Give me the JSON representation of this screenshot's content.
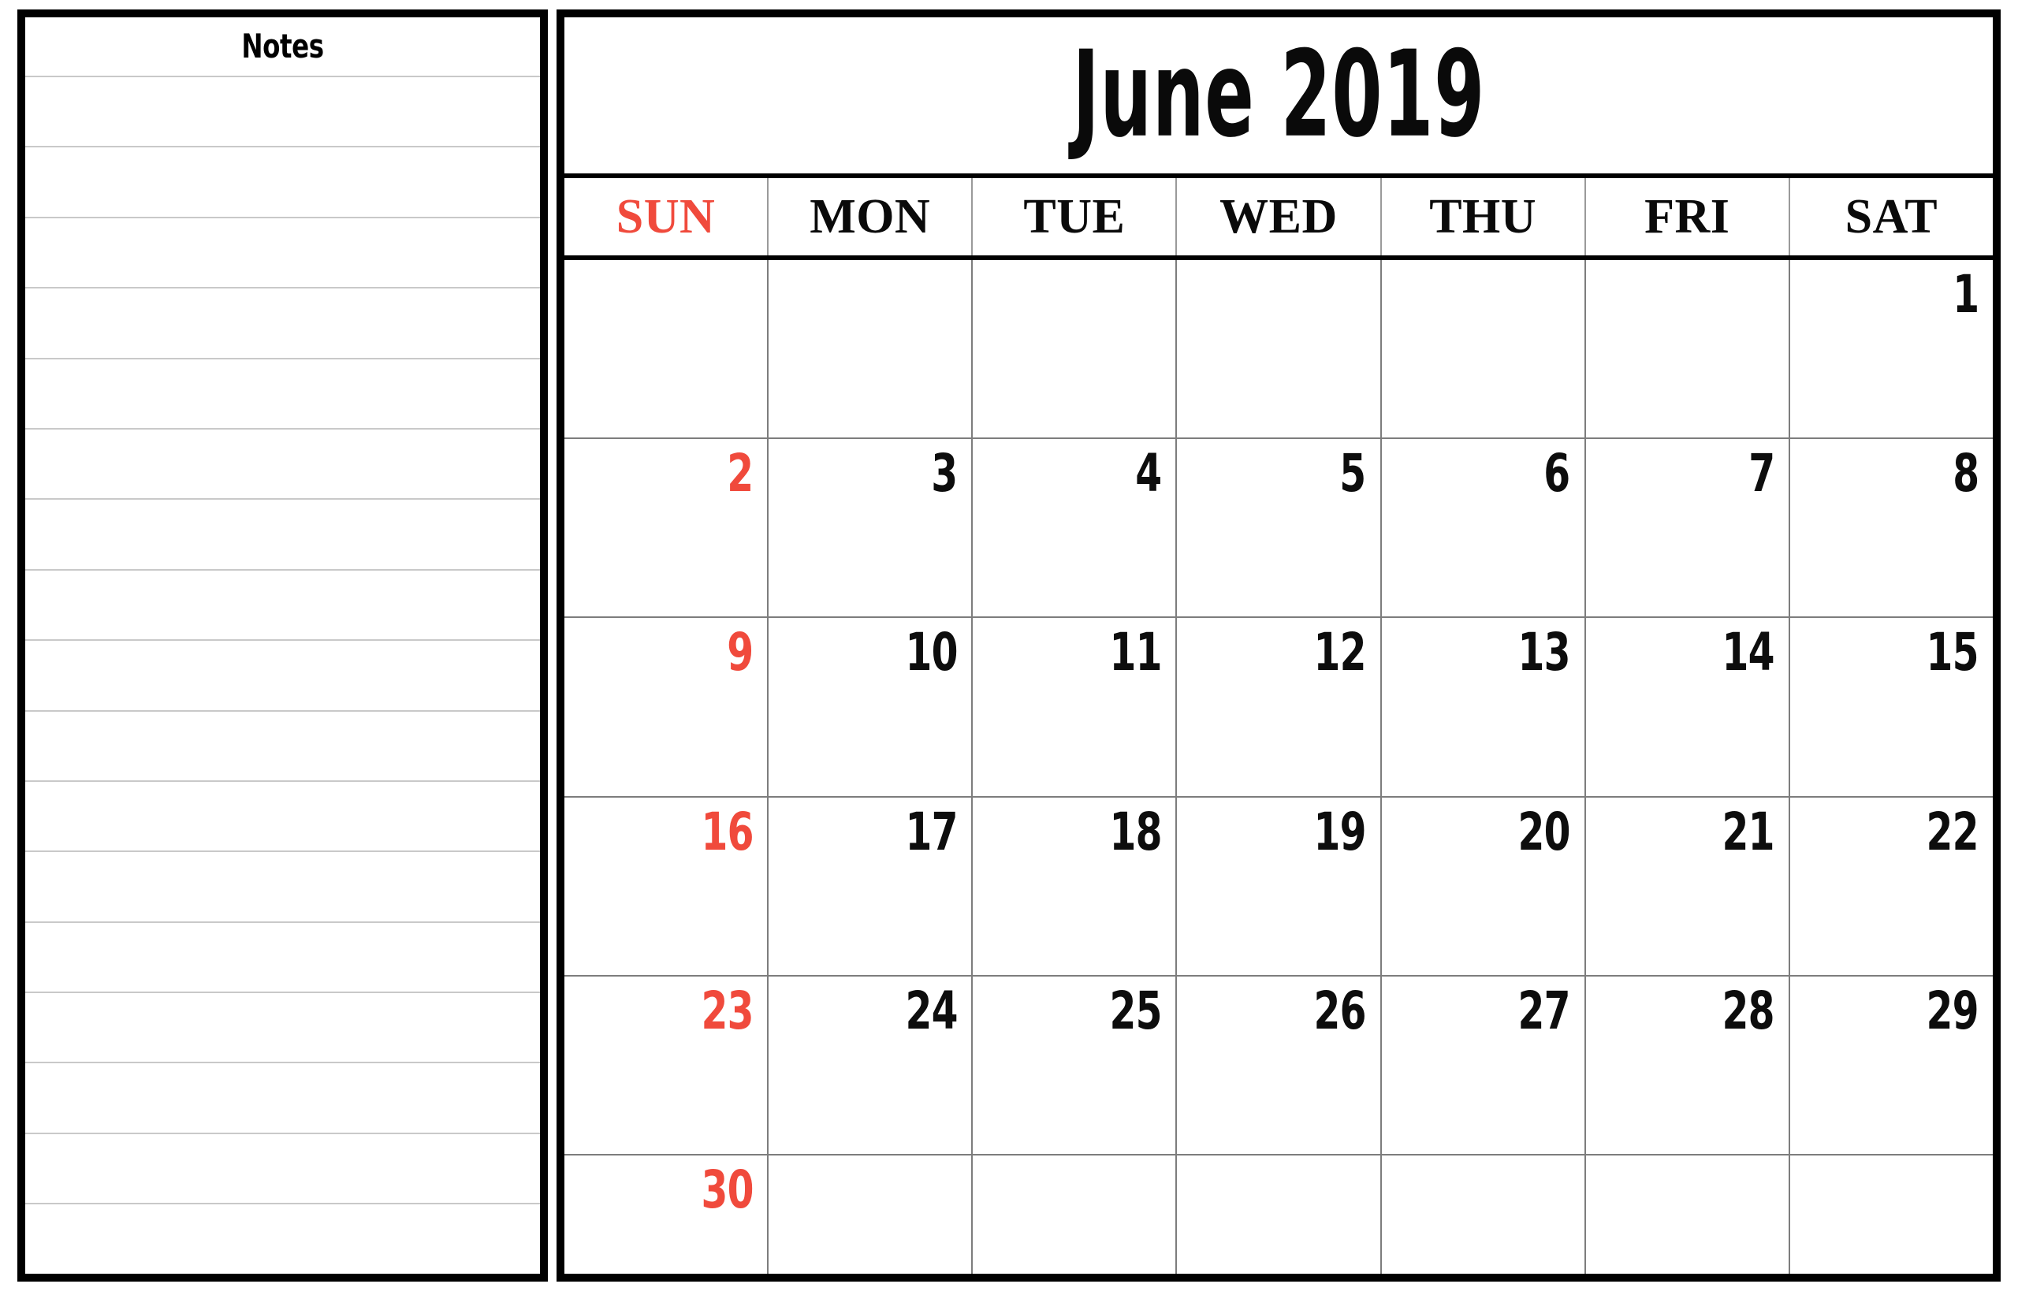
{
  "colors": {
    "sunday_red": "#f04a3c",
    "ink": "#0a0a0a",
    "frame": "#000000",
    "grid_line": "#7d7d7d",
    "note_rule": "#c9c9c9"
  },
  "notes": {
    "title": "Notes",
    "rule_count": 17
  },
  "calendar": {
    "month_title": "June 2019",
    "month": "June",
    "year": "2019",
    "weekday_headers": [
      {
        "label": "SUN",
        "is_sunday": true
      },
      {
        "label": "MON",
        "is_sunday": false
      },
      {
        "label": "TUE",
        "is_sunday": false
      },
      {
        "label": "WED",
        "is_sunday": false
      },
      {
        "label": "THU",
        "is_sunday": false
      },
      {
        "label": "FRI",
        "is_sunday": false
      },
      {
        "label": "SAT",
        "is_sunday": false
      }
    ],
    "weeks": [
      [
        "",
        "",
        "",
        "",
        "",
        "",
        "1"
      ],
      [
        "2",
        "3",
        "4",
        "5",
        "6",
        "7",
        "8"
      ],
      [
        "9",
        "10",
        "11",
        "12",
        "13",
        "14",
        "15"
      ],
      [
        "16",
        "17",
        "18",
        "19",
        "20",
        "21",
        "22"
      ],
      [
        "23",
        "24",
        "25",
        "26",
        "27",
        "28",
        "29"
      ],
      [
        "30",
        "",
        "",
        "",
        "",
        "",
        ""
      ]
    ]
  }
}
